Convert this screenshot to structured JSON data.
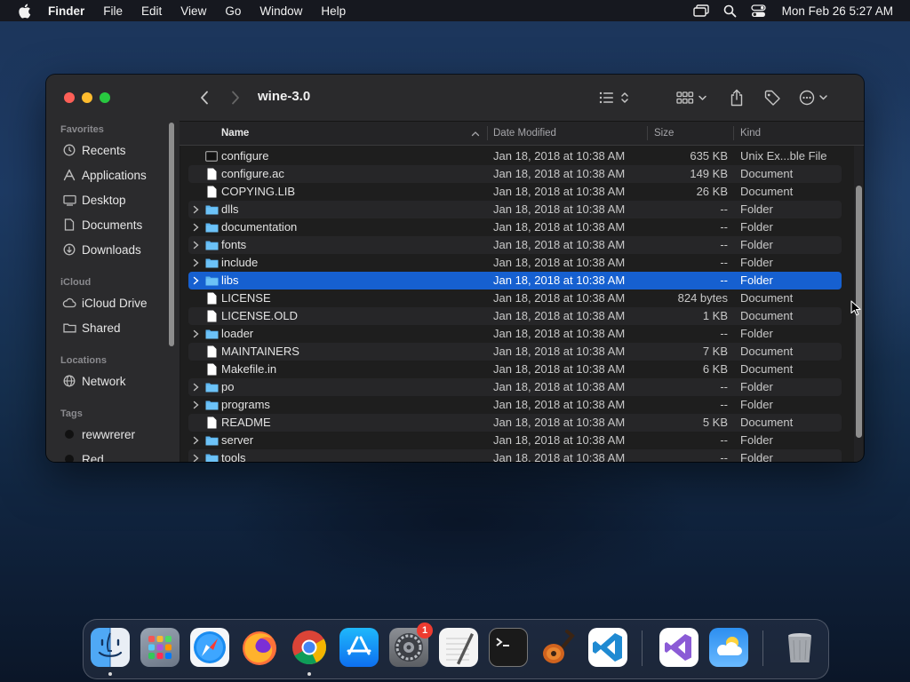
{
  "menubar": {
    "app_name": "Finder",
    "items": [
      "File",
      "Edit",
      "View",
      "Go",
      "Window",
      "Help"
    ],
    "clock": "Mon Feb 26  5:27 AM",
    "icons": [
      "screen-mirroring-icon",
      "spotlight-search-icon",
      "control-center-icon"
    ]
  },
  "window": {
    "title": "wine-3.0",
    "sidebar": {
      "sections": [
        {
          "label": "Favorites",
          "items": [
            {
              "label": "Recents",
              "icon": "clock-icon"
            },
            {
              "label": "Applications",
              "icon": "applications-icon"
            },
            {
              "label": "Desktop",
              "icon": "desktop-icon"
            },
            {
              "label": "Documents",
              "icon": "document-icon"
            },
            {
              "label": "Downloads",
              "icon": "download-icon"
            }
          ]
        },
        {
          "label": "iCloud",
          "items": [
            {
              "label": "iCloud Drive",
              "icon": "cloud-icon"
            },
            {
              "label": "Shared",
              "icon": "shared-folder-icon"
            }
          ]
        },
        {
          "label": "Locations",
          "items": [
            {
              "label": "Network",
              "icon": "globe-icon"
            }
          ]
        },
        {
          "label": "Tags",
          "items": [
            {
              "label": "rewwrerer",
              "icon": "tag-dot-icon",
              "color": "#111111"
            },
            {
              "label": "Red",
              "icon": "tag-dot-icon",
              "color": "#111111"
            }
          ]
        }
      ]
    },
    "columns": {
      "name": "Name",
      "date": "Date Modified",
      "size": "Size",
      "kind": "Kind"
    },
    "files": [
      {
        "name": "configure",
        "date": "Jan 18, 2018 at 10:38 AM",
        "size": "635 KB",
        "kind": "Unix Ex...ble File",
        "type": "exec"
      },
      {
        "name": "configure.ac",
        "date": "Jan 18, 2018 at 10:38 AM",
        "size": "149 KB",
        "kind": "Document",
        "type": "doc"
      },
      {
        "name": "COPYING.LIB",
        "date": "Jan 18, 2018 at 10:38 AM",
        "size": "26 KB",
        "kind": "Document",
        "type": "doc"
      },
      {
        "name": "dlls",
        "date": "Jan 18, 2018 at 10:38 AM",
        "size": "--",
        "kind": "Folder",
        "type": "folder"
      },
      {
        "name": "documentation",
        "date": "Jan 18, 2018 at 10:38 AM",
        "size": "--",
        "kind": "Folder",
        "type": "folder"
      },
      {
        "name": "fonts",
        "date": "Jan 18, 2018 at 10:38 AM",
        "size": "--",
        "kind": "Folder",
        "type": "folder"
      },
      {
        "name": "include",
        "date": "Jan 18, 2018 at 10:38 AM",
        "size": "--",
        "kind": "Folder",
        "type": "folder"
      },
      {
        "name": "libs",
        "date": "Jan 18, 2018 at 10:38 AM",
        "size": "--",
        "kind": "Folder",
        "type": "folder",
        "selected": true
      },
      {
        "name": "LICENSE",
        "date": "Jan 18, 2018 at 10:38 AM",
        "size": "824 bytes",
        "kind": "Document",
        "type": "doc"
      },
      {
        "name": "LICENSE.OLD",
        "date": "Jan 18, 2018 at 10:38 AM",
        "size": "1 KB",
        "kind": "Document",
        "type": "doc"
      },
      {
        "name": "loader",
        "date": "Jan 18, 2018 at 10:38 AM",
        "size": "--",
        "kind": "Folder",
        "type": "folder"
      },
      {
        "name": "MAINTAINERS",
        "date": "Jan 18, 2018 at 10:38 AM",
        "size": "7 KB",
        "kind": "Document",
        "type": "doc"
      },
      {
        "name": "Makefile.in",
        "date": "Jan 18, 2018 at 10:38 AM",
        "size": "6 KB",
        "kind": "Document",
        "type": "doc"
      },
      {
        "name": "po",
        "date": "Jan 18, 2018 at 10:38 AM",
        "size": "--",
        "kind": "Folder",
        "type": "folder"
      },
      {
        "name": "programs",
        "date": "Jan 18, 2018 at 10:38 AM",
        "size": "--",
        "kind": "Folder",
        "type": "folder"
      },
      {
        "name": "README",
        "date": "Jan 18, 2018 at 10:38 AM",
        "size": "5 KB",
        "kind": "Document",
        "type": "doc"
      },
      {
        "name": "server",
        "date": "Jan 18, 2018 at 10:38 AM",
        "size": "--",
        "kind": "Folder",
        "type": "folder"
      },
      {
        "name": "tools",
        "date": "Jan 18, 2018 at 10:38 AM",
        "size": "--",
        "kind": "Folder",
        "type": "folder"
      }
    ]
  },
  "dock": {
    "apps": [
      {
        "name": "Finder",
        "running": true
      },
      {
        "name": "Launchpad"
      },
      {
        "name": "Safari"
      },
      {
        "name": "Firefox"
      },
      {
        "name": "Chrome",
        "running": true
      },
      {
        "name": "App Store"
      },
      {
        "name": "System Preferences",
        "badge": "1"
      },
      {
        "name": "TextEdit"
      },
      {
        "name": "Terminal"
      },
      {
        "name": "GarageBand"
      },
      {
        "name": "Visual Studio Code"
      },
      {
        "name": "Visual Studio"
      },
      {
        "name": "Weather"
      },
      {
        "name": "Trash"
      }
    ],
    "colors": {
      "selection": "#1660d0",
      "folder": "#5bb4f0",
      "badge": "#ee3b30"
    }
  }
}
